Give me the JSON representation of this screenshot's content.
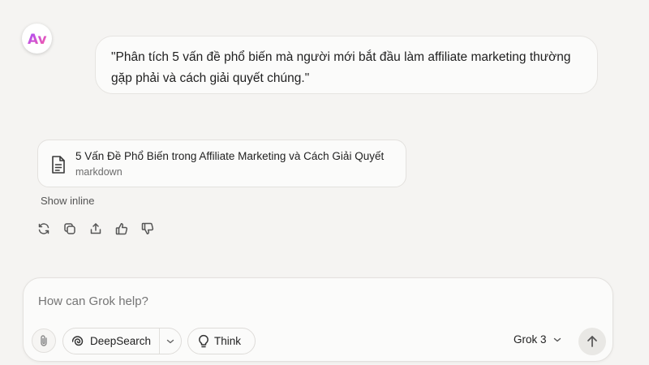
{
  "app": {
    "logo_text": "Av"
  },
  "conversation": {
    "user_message": "\"Phân tích 5 vấn đề phổ biến mà người mới bắt đầu làm affiliate marketing thường gặp phải và cách giải quyết chúng.\"",
    "artifact": {
      "title": "5 Vấn Đề Phổ Biến trong Affiliate Marketing và Cách Giải Quyết",
      "type": "markdown",
      "icon": "document-icon"
    },
    "show_inline_label": "Show inline",
    "actions": [
      {
        "name": "regenerate-icon"
      },
      {
        "name": "copy-icon"
      },
      {
        "name": "share-icon"
      },
      {
        "name": "thumbs-up-icon"
      },
      {
        "name": "thumbs-down-icon"
      }
    ]
  },
  "composer": {
    "placeholder": "How can Grok help?",
    "deepsearch_label": "DeepSearch",
    "think_label": "Think",
    "model_label": "Grok 3"
  },
  "colors": {
    "background": "#f5f4f2",
    "logo_gradient_start": "#b44dff",
    "logo_gradient_end": "#ff5c9d"
  }
}
